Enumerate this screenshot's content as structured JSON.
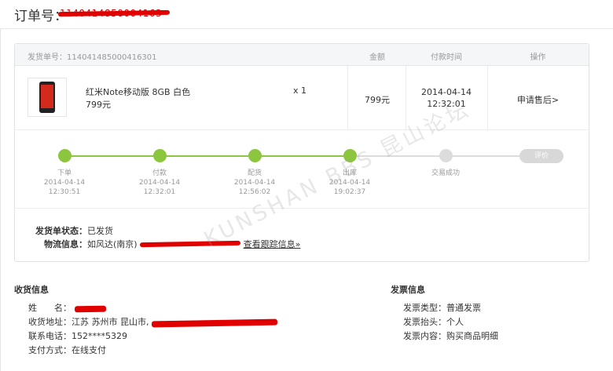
{
  "order": {
    "title": "订单号：",
    "order_no_redacted": "1140414850004163"
  },
  "shipment": {
    "ship_no_label": "发货单号：",
    "ship_no": "1140414850004163​01",
    "columns": {
      "amount": "金额",
      "pay_time": "付款时间",
      "operation": "操作"
    },
    "item": {
      "name": "红米Note移动版 8GB 白色",
      "price": "799元",
      "qty": "x 1",
      "amount": "799元",
      "pay_date": "2014-04-14",
      "pay_time": "12:32:01",
      "after_sale": "申请售后>"
    },
    "steps": [
      {
        "name": "下单",
        "date": "2014-04-14",
        "time": "12:30:51",
        "done": true
      },
      {
        "name": "付款",
        "date": "2014-04-14",
        "time": "12:32:01",
        "done": true
      },
      {
        "name": "配货",
        "date": "2014-04-14",
        "time": "12:56:02",
        "done": true
      },
      {
        "name": "出库",
        "date": "2014-04-14",
        "time": "19:02:37",
        "done": true
      },
      {
        "name": "交易成功",
        "date": "",
        "time": "",
        "done": false
      }
    ],
    "review_label": "评价",
    "status_label": "发货单状态：",
    "status_value": "已发货",
    "logistics_label": "物流信息：",
    "logistics_carrier": "如风达(南京)",
    "tracking_link": "查看跟踪信息»"
  },
  "watermark": "KUNSHAN BBS 昆山论坛",
  "receiver": {
    "title": "收货信息",
    "name_label": "姓　　名：",
    "address_label": "收货地址：",
    "address_prefix": "江苏 苏州市 昆山市,",
    "phone_label": "联系电话：",
    "phone": "152****5329",
    "payment_label": "支付方式：",
    "payment": "在线支付"
  },
  "invoice": {
    "title": "发票信息",
    "type_label": "发票类型：",
    "type": "普通发票",
    "header_label": "发票抬头：",
    "header": "个人",
    "content_label": "发票内容：",
    "content": "购买商品明细"
  },
  "colors": {
    "accent_green": "#8cc63f",
    "redact_red": "#e00000",
    "pending_gray": "#dcdcdc"
  }
}
